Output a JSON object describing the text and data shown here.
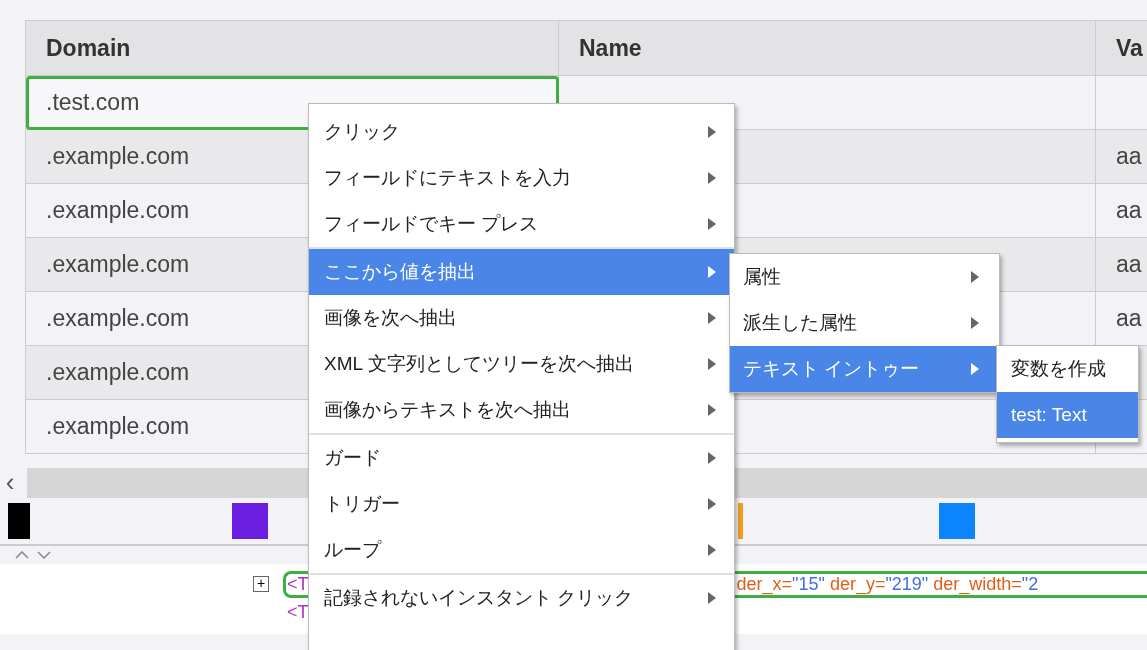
{
  "table": {
    "columns": [
      "Domain",
      "Name",
      "Va"
    ],
    "rows": [
      {
        "cells": [
          ".test.com",
          "",
          ""
        ],
        "selected": true
      },
      {
        "cells": [
          ".example.com",
          "",
          "aa"
        ],
        "selected": false
      },
      {
        "cells": [
          ".example.com",
          "",
          "aa"
        ],
        "selected": false
      },
      {
        "cells": [
          ".example.com",
          "",
          "aa"
        ],
        "selected": false
      },
      {
        "cells": [
          ".example.com",
          "",
          "aa"
        ],
        "selected": false
      },
      {
        "cells": [
          ".example.com",
          "",
          ""
        ],
        "selected": false
      },
      {
        "cells": [
          ".example.com",
          "",
          ""
        ],
        "selected": false
      }
    ]
  },
  "scrollbar": {
    "left_arrow": "‹"
  },
  "swatches": [
    {
      "color": "#000000"
    },
    {
      "color": "#6a1fe0"
    },
    {
      "color": "#f0a020"
    },
    {
      "color": "#0a84ff"
    }
  ],
  "xml_lines": [
    {
      "expander": "+",
      "outlined": true,
      "parts": [
        {
          "kind": "tag",
          "text": "<T"
        },
        {
          "kind": "attr",
          "text": "der_x="
        },
        {
          "kind": "value",
          "text": "\"15\""
        },
        {
          "kind": "attr",
          "text": " der_y="
        },
        {
          "kind": "value",
          "text": "\"219\""
        },
        {
          "kind": "attr",
          "text": " der_width="
        },
        {
          "kind": "value",
          "text": "\"2"
        }
      ]
    },
    {
      "outlined": false,
      "parts": [
        {
          "kind": "tag",
          "text": "<T"
        }
      ]
    }
  ],
  "context_menu": {
    "groups": [
      [
        {
          "label": "クリック",
          "selected": false,
          "has_submenu": true
        },
        {
          "label": "フィールドにテキストを入力",
          "selected": false,
          "has_submenu": true
        },
        {
          "label": "フィールドでキー プレス",
          "selected": false,
          "has_submenu": true
        }
      ],
      [
        {
          "label": "ここから値を抽出",
          "selected": true,
          "has_submenu": true
        },
        {
          "label": "画像を次へ抽出",
          "selected": false,
          "has_submenu": true
        },
        {
          "label": "XML 文字列としてツリーを次へ抽出",
          "selected": false,
          "has_submenu": true
        },
        {
          "label": "画像からテキストを次へ抽出",
          "selected": false,
          "has_submenu": true
        }
      ],
      [
        {
          "label": "ガード",
          "selected": false,
          "has_submenu": true
        },
        {
          "label": "トリガー",
          "selected": false,
          "has_submenu": true
        },
        {
          "label": "ループ",
          "selected": false,
          "has_submenu": true
        }
      ],
      [
        {
          "label": "記録されないインスタント クリック",
          "selected": false,
          "has_submenu": true
        }
      ]
    ]
  },
  "submenu": {
    "items": [
      {
        "label": "属性",
        "selected": false,
        "has_submenu": true
      },
      {
        "label": "派生した属性",
        "selected": false,
        "has_submenu": true
      },
      {
        "label": "テキスト イントゥー",
        "selected": true,
        "has_submenu": true
      }
    ]
  },
  "submenu_2": {
    "items": [
      {
        "label": "変数を作成",
        "selected": false
      },
      {
        "label": "test: Text",
        "selected": true
      }
    ]
  }
}
